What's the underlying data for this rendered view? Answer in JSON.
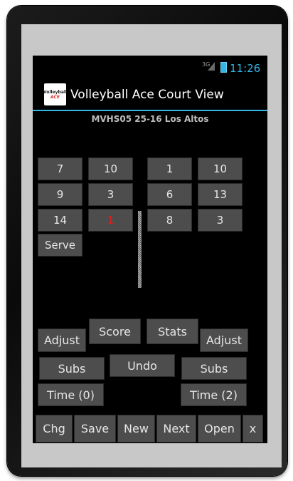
{
  "status_bar": {
    "network": "3G",
    "time": "11:26"
  },
  "action_bar": {
    "icon_text": "Volleyball",
    "icon_text_accent": "ACE",
    "title": "Volleyball Ace Court View"
  },
  "scoreboard": {
    "text": "MVHS05  25-16  Los Altos"
  },
  "court_left": {
    "row1": [
      "7",
      "10"
    ],
    "row2": [
      "9",
      "3"
    ],
    "row3": [
      "14",
      "1"
    ],
    "serve_label": "Serve"
  },
  "court_right": {
    "row1": [
      "1",
      "10"
    ],
    "row2": [
      "6",
      "13"
    ],
    "row3": [
      "8",
      "3"
    ]
  },
  "controls": {
    "adjust_left": "Adjust",
    "score": "Score",
    "stats": "Stats",
    "adjust_right": "Adjust",
    "subs_left": "Subs",
    "undo": "Undo",
    "subs_right": "Subs",
    "time_left": "Time (0)",
    "time_right": "Time (2)"
  },
  "bottom_bar": [
    "Chg",
    "Save",
    "New",
    "Next",
    "Open",
    "x"
  ],
  "colors": {
    "accent": "#33b5e5",
    "button_bg": "#4d4d4d",
    "highlight_red": "#e02020"
  }
}
